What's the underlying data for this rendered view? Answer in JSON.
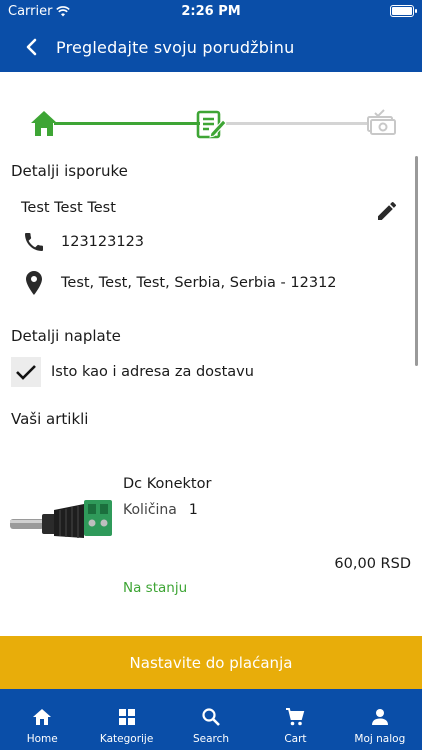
{
  "status_bar": {
    "carrier": "Carrier",
    "time": "2:26 PM"
  },
  "nav": {
    "title": "Pregledajte svoju porudžbinu"
  },
  "stepper": {
    "steps": [
      {
        "icon": "home-icon",
        "state": "completed"
      },
      {
        "icon": "form-edit-icon",
        "state": "current"
      },
      {
        "icon": "cash-icon",
        "state": "pending"
      }
    ],
    "active_color": "#3ea535",
    "inactive_color": "#d4d4d4"
  },
  "shipping": {
    "title": "Detalji isporuke",
    "name": "Test Test Test",
    "phone": "123123123",
    "address": "Test, Test, Test, Serbia, Serbia - 12312"
  },
  "billing": {
    "title": "Detalji naplate",
    "same_as_shipping_label": "Isto kao i adresa za dostavu",
    "same_as_shipping_checked": true
  },
  "items": {
    "title": "Vaši artikli",
    "list": [
      {
        "name": "Dc Konektor",
        "quantity_label": "Količina",
        "quantity": "1",
        "price": "60,00 RSD",
        "stock": "Na stanju"
      }
    ]
  },
  "cta": {
    "label": "Nastavite do plaćanja"
  },
  "tabs": [
    {
      "label": "Home",
      "icon": "home-icon"
    },
    {
      "label": "Kategorije",
      "icon": "grid-icon"
    },
    {
      "label": "Search",
      "icon": "search-icon"
    },
    {
      "label": "Cart",
      "icon": "cart-icon"
    },
    {
      "label": "Moj nalog",
      "icon": "person-icon"
    }
  ],
  "colors": {
    "brand": "#0a4ea8",
    "accent": "#e8ad0a",
    "success": "#3ea535"
  }
}
